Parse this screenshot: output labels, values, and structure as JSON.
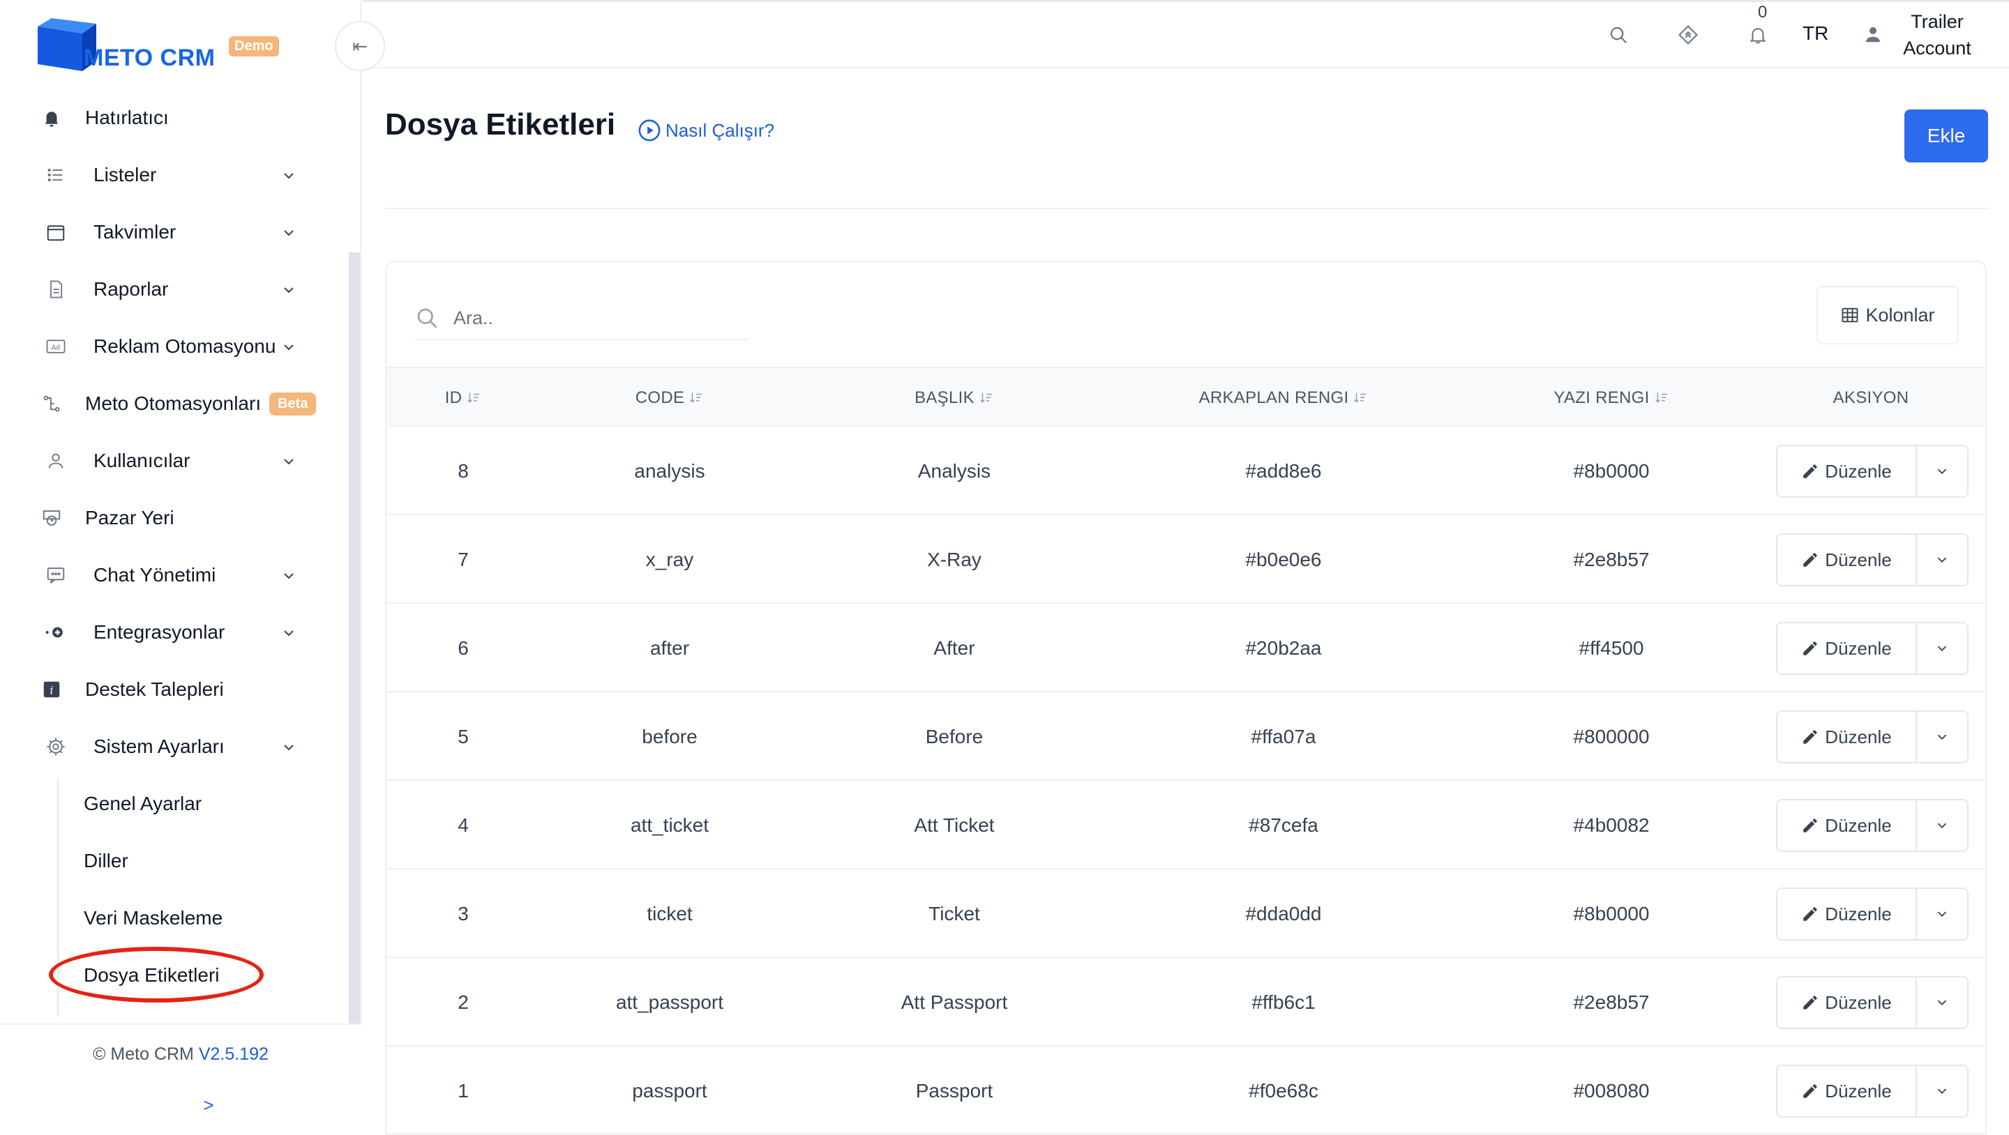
{
  "brand": {
    "name": "METO CRM",
    "badge": "Demo",
    "color": "#1864e8"
  },
  "sidebar": {
    "items": [
      {
        "label": "Hatırlatıcı",
        "icon": "bell-icon",
        "has_chevron": false
      },
      {
        "label": "Listeler",
        "icon": "list-icon",
        "has_chevron": true
      },
      {
        "label": "Takvimler",
        "icon": "calendar-icon",
        "has_chevron": true
      },
      {
        "label": "Raporlar",
        "icon": "document-icon",
        "has_chevron": true
      },
      {
        "label": "Reklam Otomasyonu",
        "icon": "ad-icon",
        "has_chevron": true
      },
      {
        "label": "Meto Otomasyonları",
        "icon": "automation-icon",
        "badge": "Beta",
        "has_chevron": false
      },
      {
        "label": "Kullanıcılar",
        "icon": "user-icon",
        "has_chevron": true
      },
      {
        "label": "Pazar Yeri",
        "icon": "marketplace-icon",
        "has_chevron": false
      },
      {
        "label": "Chat Yönetimi",
        "icon": "chat-icon",
        "has_chevron": true
      },
      {
        "label": "Entegrasyonlar",
        "icon": "integration-icon",
        "has_chevron": true
      },
      {
        "label": "Destek Talepleri",
        "icon": "info-icon",
        "has_chevron": false
      },
      {
        "label": "Sistem Ayarları",
        "icon": "gear-icon",
        "has_chevron": true
      }
    ],
    "sub_items": [
      {
        "label": "Genel Ayarlar"
      },
      {
        "label": "Diller"
      },
      {
        "label": "Veri Maskeleme"
      },
      {
        "label": "Dosya Etiketleri"
      }
    ],
    "footer": {
      "copyright": "© Meto CRM",
      "version": "V2.5.192",
      "expand": ">"
    },
    "collapse_glyph": "⇤"
  },
  "topbar": {
    "notification_count": "0",
    "language": "TR",
    "account_line1": "Trailer",
    "account_line2": "Account"
  },
  "page": {
    "title": "Dosya Etiketleri",
    "help_link": "Nasıl Çalışır?",
    "add_button": "Ekle"
  },
  "table": {
    "search_placeholder": "Ara..",
    "columns_button": "Kolonlar",
    "headers": [
      "ID",
      "CODE",
      "BAŞLIK",
      "ARKAPLAN RENGI",
      "YAZI RENGI",
      "AKSIYON"
    ],
    "edit_label": "Düzenle",
    "rows": [
      {
        "id": "8",
        "code": "analysis",
        "title": "Analysis",
        "bg": "#add8e6",
        "fg": "#8b0000"
      },
      {
        "id": "7",
        "code": "x_ray",
        "title": "X-Ray",
        "bg": "#b0e0e6",
        "fg": "#2e8b57"
      },
      {
        "id": "6",
        "code": "after",
        "title": "After",
        "bg": "#20b2aa",
        "fg": "#ff4500"
      },
      {
        "id": "5",
        "code": "before",
        "title": "Before",
        "bg": "#ffa07a",
        "fg": "#800000"
      },
      {
        "id": "4",
        "code": "att_ticket",
        "title": "Att Ticket",
        "bg": "#87cefa",
        "fg": "#4b0082"
      },
      {
        "id": "3",
        "code": "ticket",
        "title": "Ticket",
        "bg": "#dda0dd",
        "fg": "#8b0000"
      },
      {
        "id": "2",
        "code": "att_passport",
        "title": "Att Passport",
        "bg": "#ffb6c1",
        "fg": "#2e8b57"
      },
      {
        "id": "1",
        "code": "passport",
        "title": "Passport",
        "bg": "#f0e68c",
        "fg": "#008080"
      }
    ]
  },
  "colors": {
    "primary": "#2d6cf0",
    "highlight": "#e42313",
    "beta_badge": "#f4b67a"
  }
}
